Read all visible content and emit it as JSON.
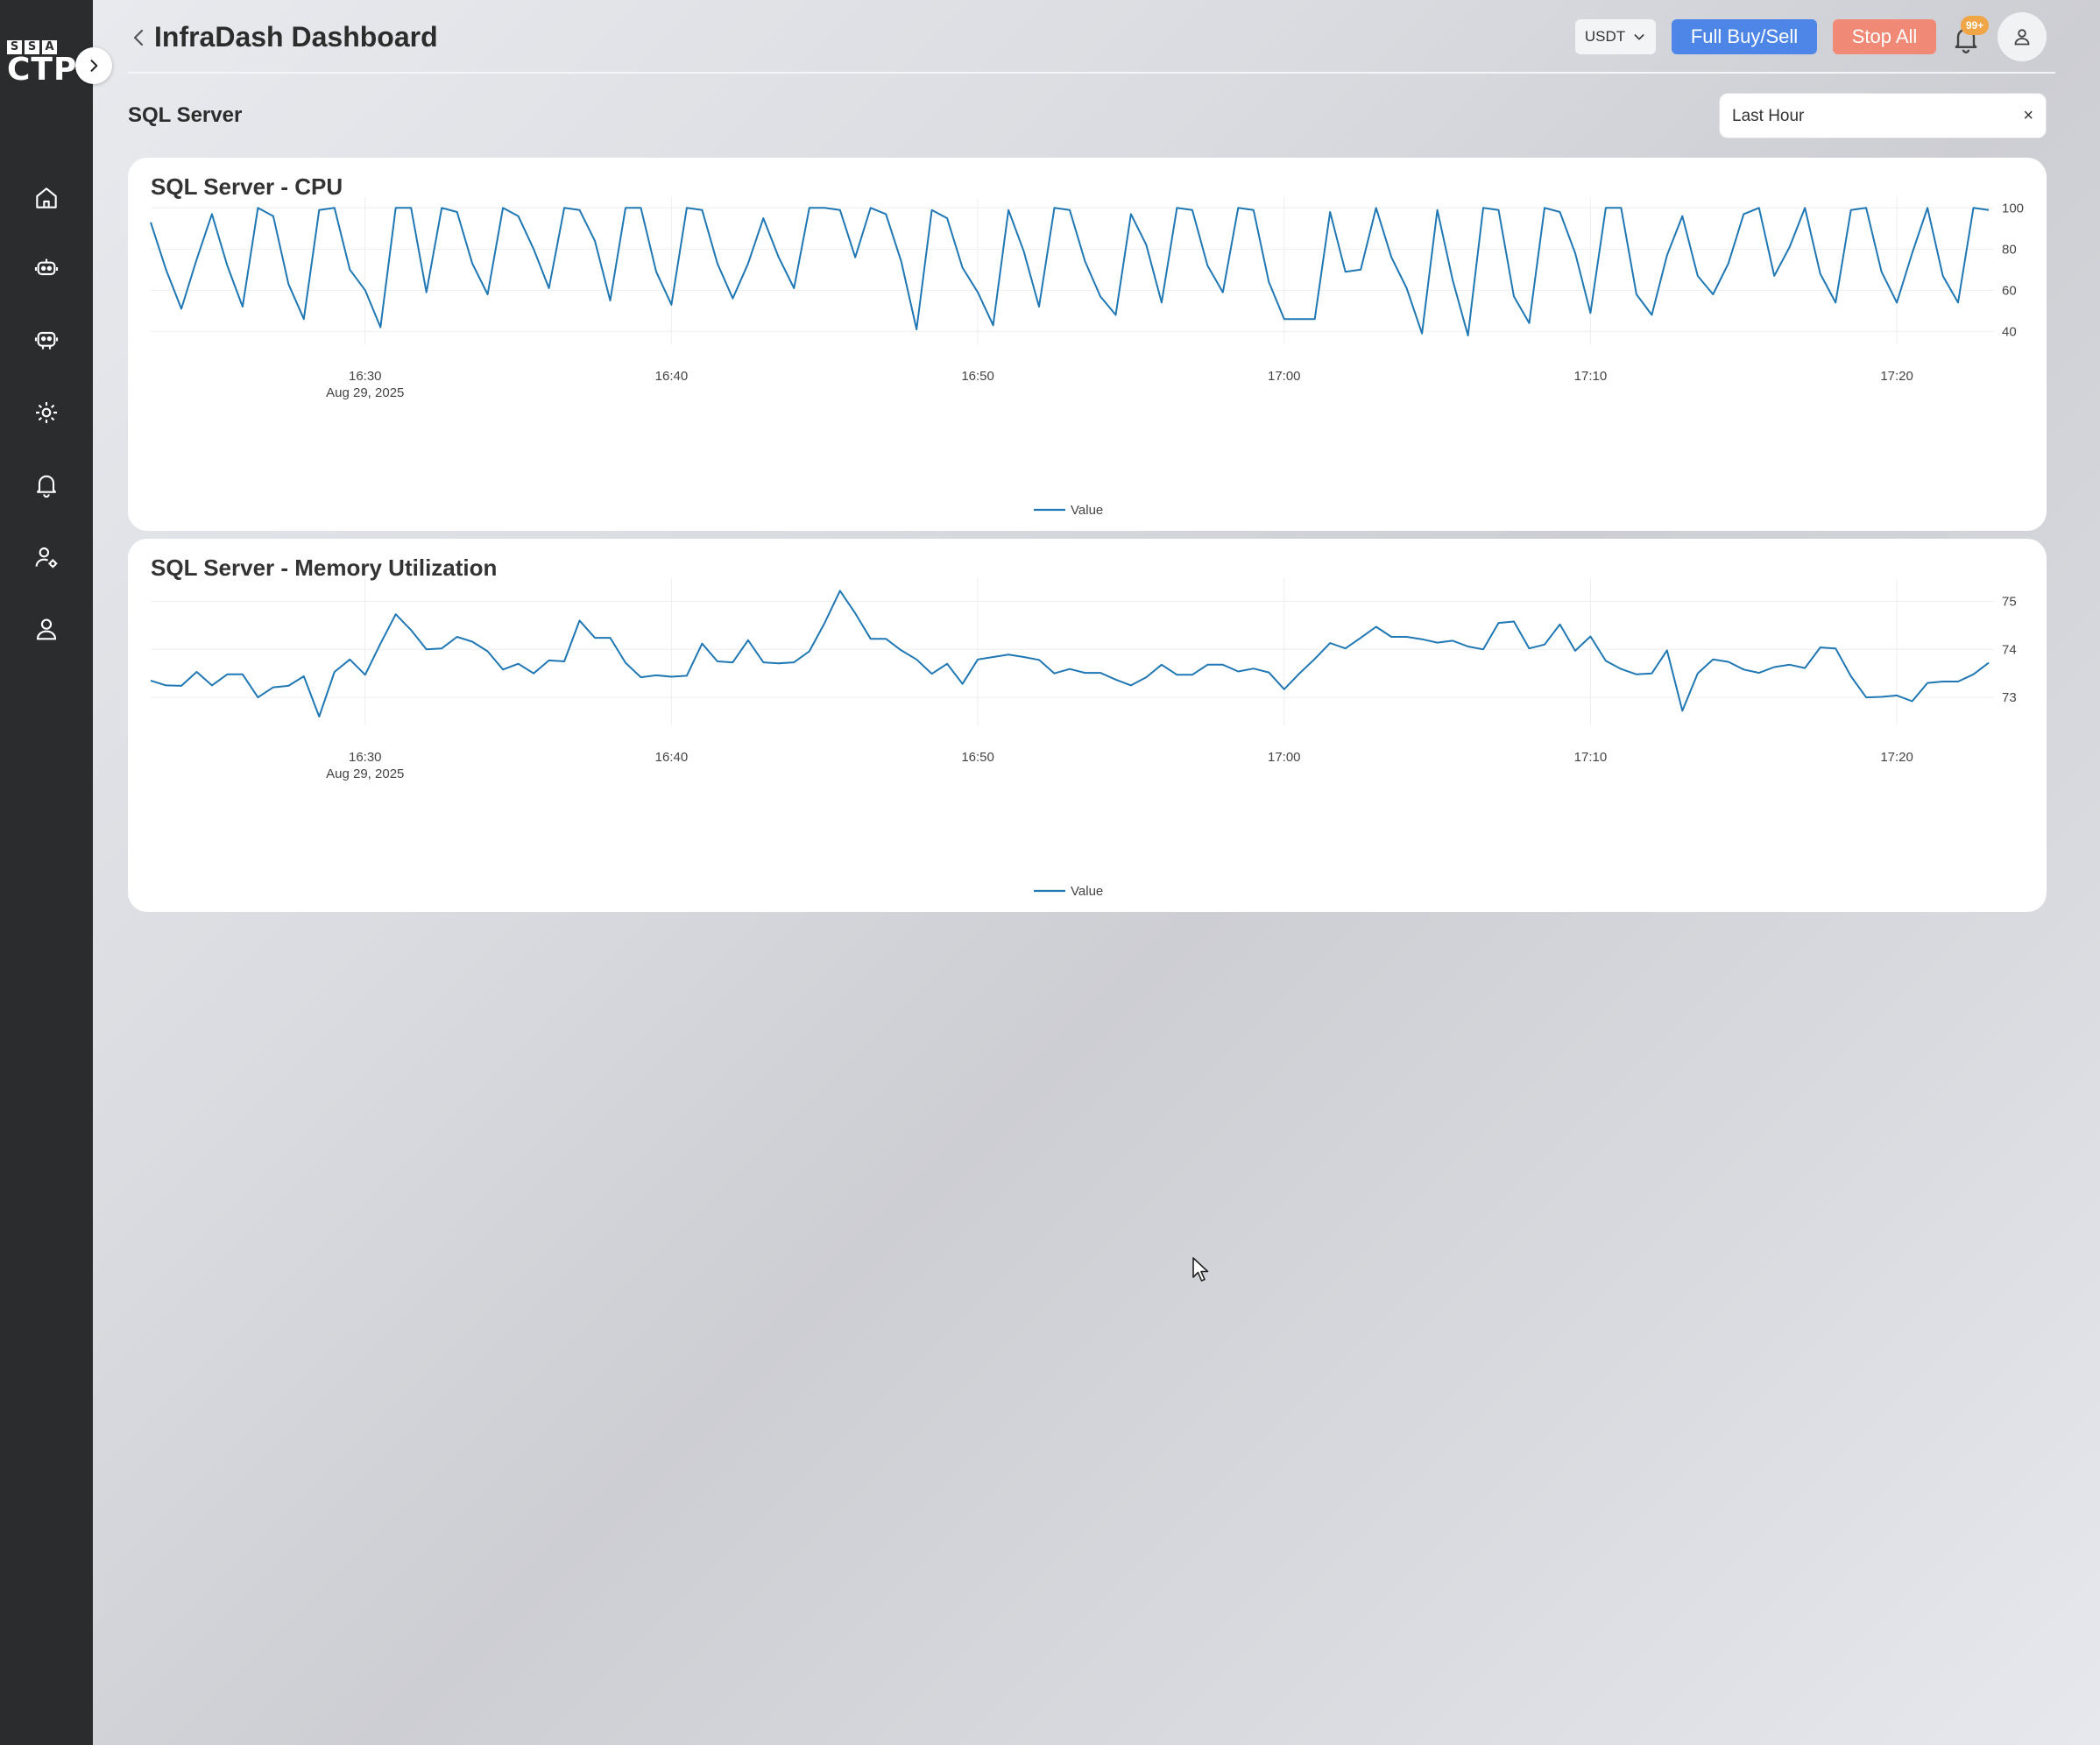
{
  "app": {
    "logo_top": [
      "S",
      "S",
      "A"
    ],
    "logo_bottom": "CTP"
  },
  "header": {
    "title": "InfraDash Dashboard",
    "currency": "USDT",
    "full_buy_sell_label": "Full Buy/Sell",
    "stop_all_label": "Stop All",
    "notification_badge": "99+"
  },
  "section": {
    "title": "SQL Server"
  },
  "time_range": {
    "value": "Last Hour",
    "clear_symbol": "×"
  },
  "colors": {
    "line": "#1f77b4",
    "primary": "#4d86e7",
    "danger": "#f08a76",
    "badge": "#f0a646",
    "sidebar": "#2b2c2e"
  },
  "sidebar": {
    "items": [
      {
        "icon": "home-icon"
      },
      {
        "icon": "bot-icon"
      },
      {
        "icon": "bot-settings-icon"
      },
      {
        "icon": "gear-icon"
      },
      {
        "icon": "bell-icon"
      },
      {
        "icon": "user-settings-icon"
      },
      {
        "icon": "user-icon"
      }
    ]
  },
  "chart_data": [
    {
      "type": "line",
      "title": "SQL Server - CPU",
      "xlabel": "",
      "ylabel": "",
      "x_ticks": [
        "16:30",
        "16:40",
        "16:50",
        "17:00",
        "17:10",
        "17:20"
      ],
      "x_tick_sub": "Aug 29, 2025",
      "x_range": [
        "16:23",
        "17:23"
      ],
      "yticks": [
        40,
        60,
        80,
        100
      ],
      "ylim": [
        38,
        101
      ],
      "legend": "bottom-center",
      "grid": true,
      "series": [
        {
          "name": "Value",
          "values": [
            93,
            70,
            51,
            75,
            97,
            72,
            52,
            100,
            96,
            63,
            46,
            99,
            100,
            70,
            60,
            42,
            100,
            100,
            59,
            100,
            98,
            73,
            58,
            100,
            96,
            80,
            61,
            100,
            99,
            84,
            55,
            100,
            100,
            69,
            53,
            100,
            99,
            73,
            56,
            73,
            95,
            76,
            61,
            100,
            100,
            99,
            76,
            100,
            97,
            74,
            41,
            99,
            95,
            71,
            59,
            43,
            99,
            79,
            52,
            100,
            99,
            74,
            57,
            48,
            97,
            82,
            54,
            100,
            99,
            72,
            59,
            100,
            99,
            64,
            46,
            46,
            46,
            98,
            69,
            70,
            100,
            76,
            61,
            39,
            99,
            65,
            38,
            100,
            99,
            57,
            44,
            100,
            98,
            78,
            49,
            100,
            100,
            58,
            48,
            77,
            96,
            67,
            58,
            73,
            97,
            100,
            67,
            81,
            100,
            68,
            54,
            99,
            100,
            69,
            54,
            78,
            100,
            67,
            54,
            100,
            99
          ]
        }
      ]
    },
    {
      "type": "line",
      "title": "SQL Server - Memory Utilization",
      "xlabel": "",
      "ylabel": "",
      "x_ticks": [
        "16:30",
        "16:40",
        "16:50",
        "17:00",
        "17:10",
        "17:20"
      ],
      "x_tick_sub": "Aug 29, 2025",
      "x_range": [
        "16:23",
        "17:23"
      ],
      "yticks": [
        73,
        74,
        75
      ],
      "ylim": [
        72.6,
        75.3
      ],
      "legend": "bottom-center",
      "grid": true,
      "series": [
        {
          "name": "Value",
          "values": [
            73.35,
            73.25,
            73.24,
            73.53,
            73.25,
            73.48,
            73.48,
            73.0,
            73.21,
            73.24,
            73.44,
            72.6,
            73.53,
            73.79,
            73.47,
            74.12,
            74.73,
            74.4,
            74.0,
            74.02,
            74.26,
            74.16,
            73.96,
            73.58,
            73.7,
            73.5,
            73.77,
            73.75,
            74.6,
            74.24,
            74.24,
            73.72,
            73.42,
            73.46,
            73.43,
            73.45,
            74.12,
            73.75,
            73.73,
            74.19,
            73.73,
            73.71,
            73.73,
            73.96,
            74.55,
            75.22,
            74.75,
            74.22,
            74.22,
            73.98,
            73.79,
            73.49,
            73.7,
            73.28,
            73.79,
            73.84,
            73.89,
            73.84,
            73.78,
            73.5,
            73.59,
            73.51,
            73.51,
            73.37,
            73.25,
            73.42,
            73.68,
            73.47,
            73.47,
            73.68,
            73.68,
            73.54,
            73.6,
            73.52,
            73.17,
            73.5,
            73.8,
            74.13,
            74.02,
            74.24,
            74.47,
            74.26,
            74.26,
            74.21,
            74.14,
            74.18,
            74.06,
            74.0,
            74.55,
            74.58,
            74.02,
            74.1,
            74.52,
            73.97,
            74.27,
            73.76,
            73.59,
            73.48,
            73.5,
            73.98,
            72.72,
            73.5,
            73.79,
            73.74,
            73.58,
            73.51,
            73.63,
            73.68,
            73.61,
            74.04,
            74.02,
            73.44,
            73.0,
            73.01,
            73.04,
            72.92,
            73.3,
            73.33,
            73.33,
            73.48,
            73.72
          ]
        }
      ]
    }
  ]
}
